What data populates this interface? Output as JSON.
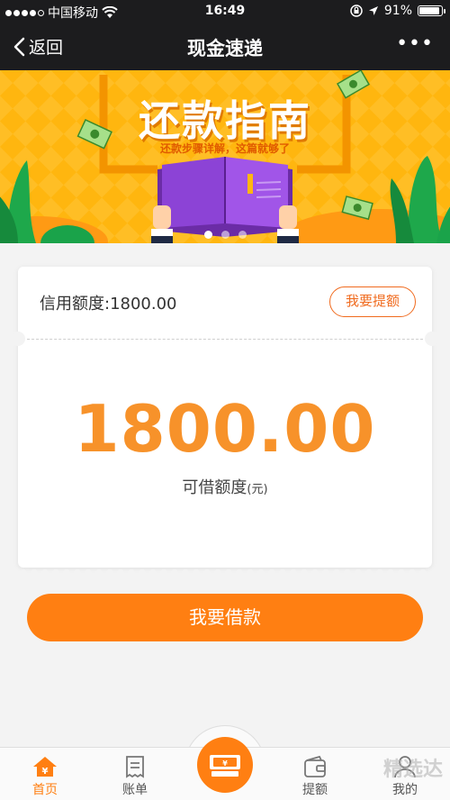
{
  "status_bar": {
    "carrier": "中国移动",
    "time": "16:49",
    "battery": "91%",
    "battery_level": 0.91
  },
  "nav": {
    "back_label": "返回",
    "title": "现金速递",
    "more_label": "•••"
  },
  "banner": {
    "title": "还款指南",
    "subtitle": "还款步骤详解，这篇就够了",
    "page_count": 3,
    "active_page": 1
  },
  "card": {
    "credit_limit_label": "信用额度:1800.00",
    "raise_button": "我要提额",
    "amount": "1800.00",
    "amount_label": "可借额度",
    "amount_unit": "(元)"
  },
  "borrow_button": "我要借款",
  "tabbar": {
    "tabs": [
      {
        "label": "首页",
        "icon": "home-yen-icon",
        "active": true
      },
      {
        "label": "账单",
        "icon": "bill-icon",
        "active": false
      },
      {
        "label": "提额",
        "icon": "wallet-icon",
        "active": false
      },
      {
        "label": "我的",
        "icon": "user-icon",
        "active": false
      }
    ],
    "center_icon": "cash-icon"
  },
  "watermark": "精选达",
  "colors": {
    "accent": "#ff7f12",
    "amount": "#f7922a",
    "banner": "#ffb60f",
    "header": "#1c1c1e"
  }
}
